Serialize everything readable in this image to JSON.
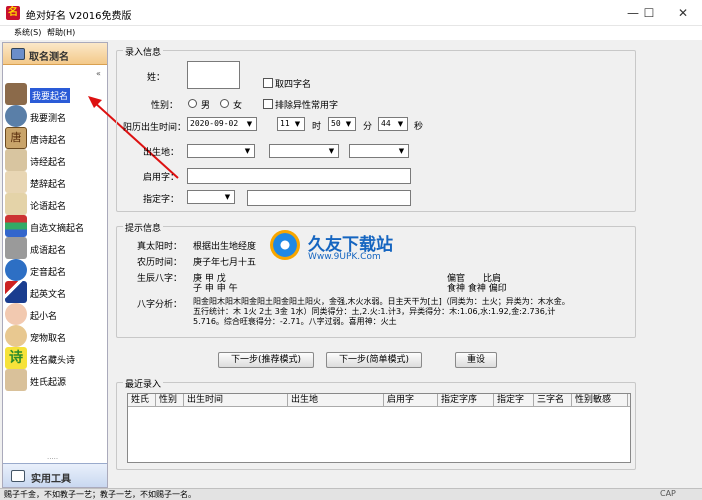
{
  "window": {
    "title": "绝对好名 V2016免费版",
    "minimize": "—",
    "maximize": "☐",
    "close": "✕"
  },
  "menu": [
    "系统(S)",
    "帮助(H)"
  ],
  "sidebar": {
    "header": "取名测名",
    "scroll_up": "«",
    "items": [
      {
        "label": "我要起名",
        "selected": true
      },
      {
        "label": "我要测名"
      },
      {
        "label": "唐诗起名"
      },
      {
        "label": "诗经起名"
      },
      {
        "label": "楚辞起名"
      },
      {
        "label": "论语起名"
      },
      {
        "label": "自选文摘起名"
      },
      {
        "label": "成语起名"
      },
      {
        "label": "定音起名"
      },
      {
        "label": "起英文名"
      },
      {
        "label": "起小名"
      },
      {
        "label": "宠物取名"
      },
      {
        "label": "姓名藏头诗"
      },
      {
        "label": "姓氏起源"
      }
    ],
    "grip": ".....",
    "footer": "实用工具"
  },
  "form": {
    "group_title": "录入信息",
    "surname_label": "姓：",
    "four_char_label": "取四字名",
    "gender_label": "性别：",
    "male": "男",
    "female": "女",
    "exclude_label": "排除异性常用字",
    "birth_label": "阳历出生时间：",
    "date": "2020-09-02",
    "hour": "11",
    "hour_unit": "时",
    "minute": "50",
    "minute_unit": "分",
    "second": "44",
    "second_unit": "秒",
    "birthplace_label": "出生地：",
    "gen_char_label": "启用字：",
    "fixed_char_label": "指定字："
  },
  "info": {
    "group_title": "提示信息",
    "solar_label": "真太阳时：",
    "solar_value": "根据出生地经度",
    "lunar_label": "农历时间：",
    "lunar_value": "庚子年七月十五",
    "bazi_label": "生辰八字：",
    "bazi_top": "庚 甲 戊",
    "bazi_bottom": "子 申 申 午",
    "shishen_top": "偏官　　比肩",
    "shishen_bottom": "食神 食神 偏印",
    "analysis_label": "八字分析：",
    "analysis_lines": [
      "阳金阳木阳木阳金阳土阳金阳土阳火，金强,木火水弱。日主天干为[土]（同类为：土火；异类为：木水金。",
      "五行统计：木 1火 2土 3金 1水）同类得分：土,2.火:1.计3，异类得分：木:1.06,水:1.92,金:2.736,计",
      "5.716。综合旺衰得分：-2.71。八字过弱。喜用神：火土"
    ]
  },
  "buttons": {
    "next_recommend": "下一步(推荐模式)",
    "next_simple": "下一步(简单模式)",
    "reset": "重设"
  },
  "recent": {
    "group_title": "最近录入",
    "columns": [
      "姓氏",
      "性别",
      "出生时间",
      "出生地",
      "启用字",
      "指定字序",
      "指定字",
      "三字名",
      "性别敏感"
    ]
  },
  "status": {
    "text": "赐子千金，不如教子一艺；教子一艺，不如赐子一名。",
    "cap": "CAP"
  },
  "watermark": {
    "title": "久友下载站",
    "url": "Www.9UPK.Com"
  },
  "colors": {
    "accent": "#2a5bd7",
    "arrow": "#d11",
    "title_icon": "#c8102e"
  }
}
